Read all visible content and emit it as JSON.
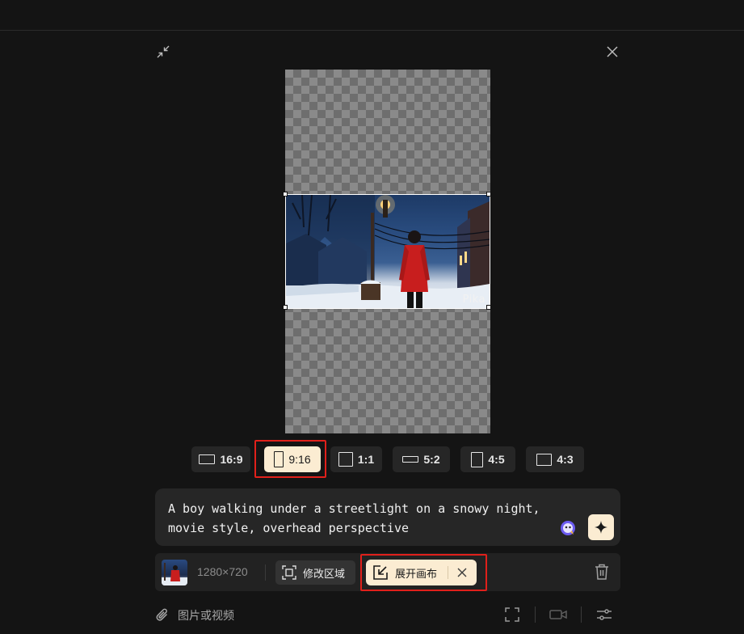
{
  "window": {
    "collapse_icon": "collapse-arrows-icon",
    "close_icon": "close-icon"
  },
  "canvas": {
    "watermark": "Pika"
  },
  "aspect_ratios": [
    {
      "label": "16:9",
      "active": false
    },
    {
      "label": "9:16",
      "active": true
    },
    {
      "label": "1:1",
      "active": false
    },
    {
      "label": "5:2",
      "active": false
    },
    {
      "label": "4:5",
      "active": false
    },
    {
      "label": "4:3",
      "active": false
    }
  ],
  "prompt": {
    "text": "A boy walking under a streetlight on a snowy night, movie style, overhead perspective",
    "ai_icon": "ai-assistant-icon",
    "sparkle_icon": "sparkle-icon"
  },
  "media_bar": {
    "dimensions": "1280×720",
    "modify_region_label": "修改区域",
    "expand_canvas_label": "展开画布",
    "trash_icon": "trash-icon"
  },
  "footer": {
    "attach_label": "图片或视频",
    "fullscreen_icon": "fullscreen-icon",
    "video_icon": "video-camera-icon",
    "settings_icon": "sliders-icon"
  },
  "colors": {
    "background": "#141414",
    "active_pill": "#fbecd2",
    "highlight": "#e0201b"
  }
}
